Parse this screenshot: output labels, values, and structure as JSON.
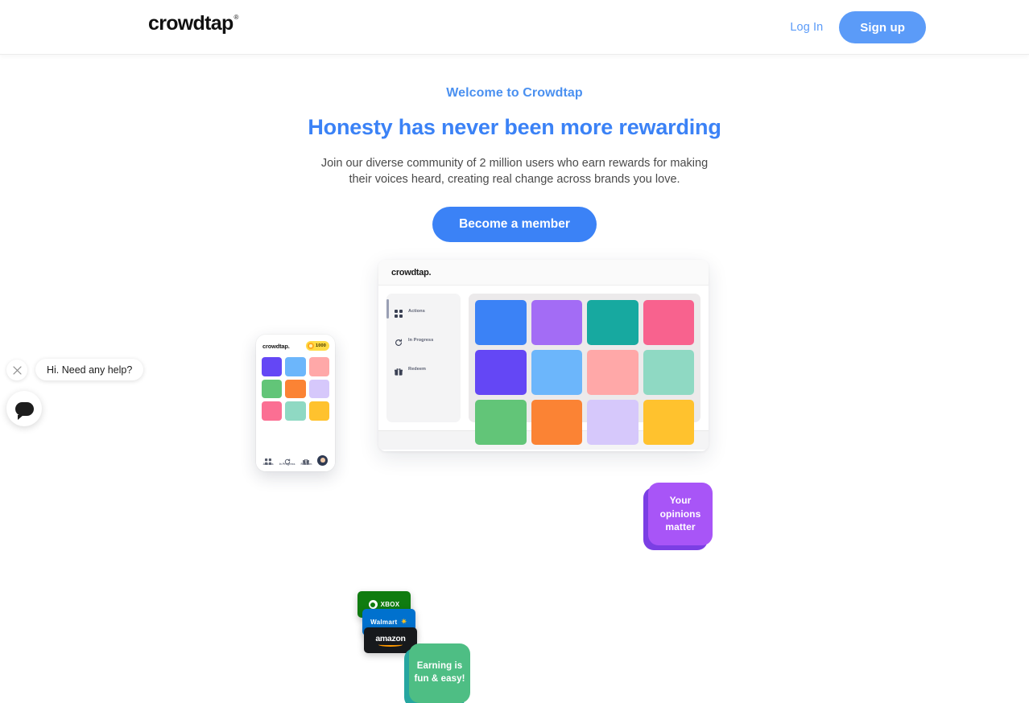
{
  "header": {
    "logo_text": "crowdtap",
    "logo_reg": "®",
    "login_label": "Log In",
    "signup_label": "Sign up",
    "accent_color": "#5B9BF8"
  },
  "hero": {
    "eyebrow": "Welcome to Crowdtap",
    "headline": "Honesty has never been more rewarding",
    "subcopy": "Join our diverse community of 2 million users who earn rewards for making their voices heard, creating real change across brands you love.",
    "cta_label": "Become a member",
    "cta_color": "#3B82F6",
    "headline_color": "#3B82F6"
  },
  "illustration": {
    "desktop": {
      "logo_text": "crowdtap.",
      "sidebar": [
        {
          "label": "Actions",
          "icon": "grid-icon"
        },
        {
          "label": "In Progress",
          "icon": "refresh-icon"
        },
        {
          "label": "Redeem",
          "icon": "gift-icon"
        }
      ],
      "tiles": [
        "#3B82F6",
        "#A36CF5",
        "#17A9A0",
        "#F8628E",
        "#6447F5",
        "#6CB6FB",
        "#FFA8A8",
        "#8FD9C3",
        "#62C578",
        "#FB8334",
        "#D6C8FB",
        "#FFC22E"
      ]
    },
    "phone": {
      "logo_text": "crowdtap.",
      "points": "1000",
      "points_bg": "#FFDA44",
      "tiles": [
        "#6447F5",
        "#6CB6FB",
        "#FFA8A8",
        "#62C578",
        "#FB8334",
        "#D6C8FB",
        "#FB6F93",
        "#8FD9C3",
        "#FFC22E"
      ],
      "nav": [
        {
          "label": "Actions",
          "icon": "grid-icon"
        },
        {
          "label": "In Progress",
          "icon": "refresh-icon"
        },
        {
          "label": "Redeem",
          "icon": "gift-icon"
        }
      ],
      "avatar_name": "user-avatar"
    },
    "gift_cards": [
      {
        "brand": "XBOX",
        "color": "#107C10"
      },
      {
        "brand": "Walmart",
        "color": "#0071CE"
      },
      {
        "brand": "amazon",
        "color": "#17191C"
      }
    ],
    "badges": [
      {
        "text": "Your opinions matter",
        "color": "#A855F7",
        "shadow": "#7B3FE4"
      },
      {
        "text": "Earning is fun & easy!",
        "color": "#4EBE84",
        "shadow": "#26A6A0"
      }
    ]
  },
  "chat": {
    "message": "Hi. Need any help?",
    "close_label": "✕"
  }
}
